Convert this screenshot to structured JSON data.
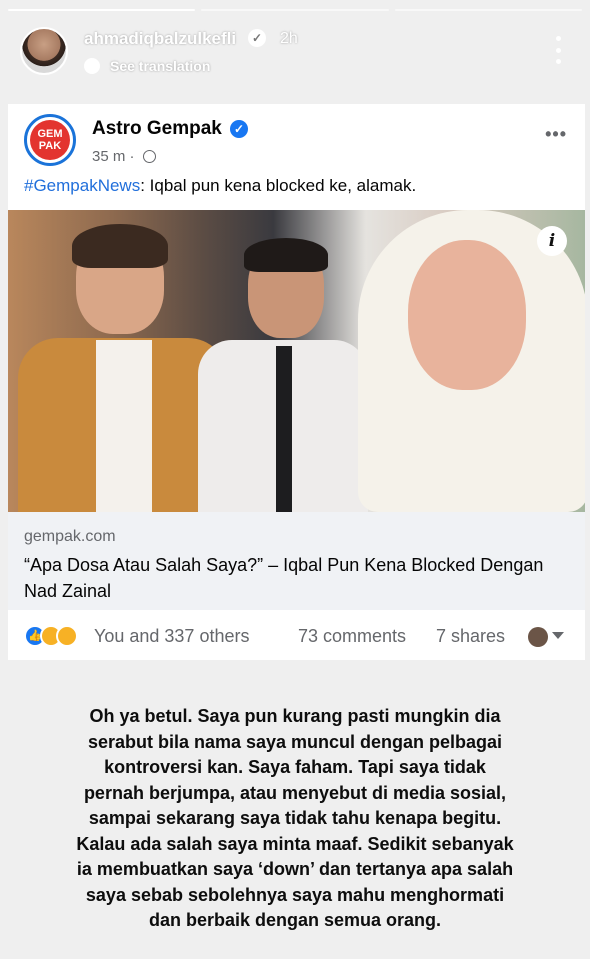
{
  "story": {
    "username": "ahmadiqbalzulkefli",
    "time": "2h",
    "translate_label": "See translation"
  },
  "post": {
    "logo_text": "GEMPAK",
    "page_name": "Astro Gempak",
    "timestamp": "35 m ·",
    "hashtag": "#GempakNews",
    "text": ": Iqbal pun kena blocked ke, alamak.",
    "link_domain": "gempak.com",
    "link_title": "“Apa Dosa Atau Salah Saya?” – Iqbal Pun Kena Blocked Dengan Nad Zainal",
    "reactions_text": "You and 337 others",
    "comments": "73 comments",
    "shares": "7 shares"
  },
  "caption_lines": [
    "Oh ya betul. Saya pun kurang pasti mungkin dia",
    "serabut bila nama saya muncul dengan pelbagai",
    "kontroversi kan. Saya faham. Tapi saya tidak",
    "pernah berjumpa, atau menyebut di media sosial,",
    "sampai sekarang saya tidak tahu kenapa begitu.",
    "Kalau ada salah saya minta maaf. Sedikit sebanyak",
    "ia membuatkan saya ‘down’ dan tertanya apa salah",
    "saya sebab sebolehnya saya mahu menghormati",
    "dan berbaik dengan semua orang."
  ],
  "colors": {
    "link_blue": "#216fdb",
    "verified_blue": "#1877f2",
    "gempak_red": "#e3342f"
  },
  "icons": [
    "verified-icon",
    "translate-icon",
    "more-icon",
    "globe-icon",
    "info-icon",
    "like-reaction-icon",
    "haha-reaction-icon",
    "care-reaction-icon",
    "caret-down-icon"
  ]
}
